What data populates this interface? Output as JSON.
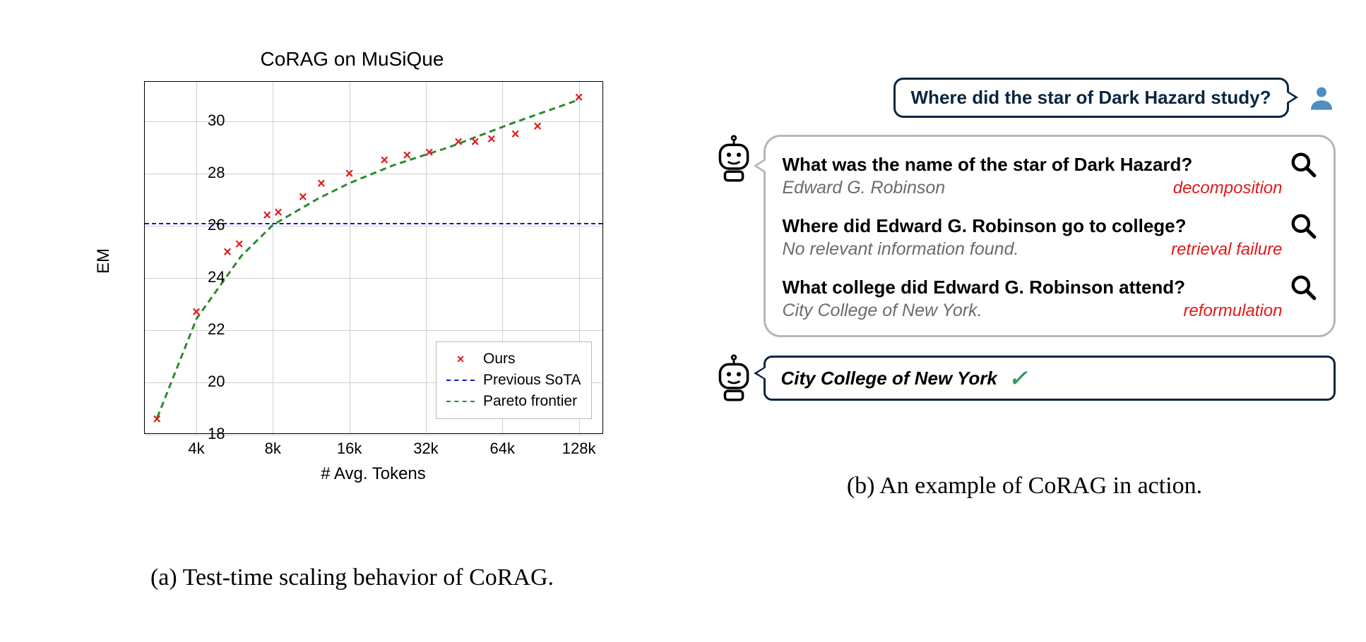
{
  "chart_data": {
    "type": "scatter",
    "title": "CoRAG on MuSiQue",
    "xlabel": "# Avg. Tokens",
    "ylabel": "EM",
    "xscale": "log",
    "xlim": [
      2500,
      160000
    ],
    "ylim": [
      18,
      31.5
    ],
    "xticks": [
      "4k",
      "8k",
      "16k",
      "32k",
      "64k",
      "128k"
    ],
    "yticks": [
      18,
      20,
      22,
      24,
      26,
      28,
      30
    ],
    "series": [
      {
        "name": "Ours",
        "type": "scatter",
        "marker": "x",
        "color": "#e11919",
        "points": [
          {
            "x": 2800,
            "y": 18.6
          },
          {
            "x": 4000,
            "y": 22.7
          },
          {
            "x": 5300,
            "y": 25.0
          },
          {
            "x": 5900,
            "y": 25.3
          },
          {
            "x": 7600,
            "y": 26.4
          },
          {
            "x": 8400,
            "y": 26.5
          },
          {
            "x": 10500,
            "y": 27.1
          },
          {
            "x": 12400,
            "y": 27.6
          },
          {
            "x": 16000,
            "y": 28.0
          },
          {
            "x": 22000,
            "y": 28.5
          },
          {
            "x": 27000,
            "y": 28.7
          },
          {
            "x": 33000,
            "y": 28.8
          },
          {
            "x": 43000,
            "y": 29.2
          },
          {
            "x": 50000,
            "y": 29.2
          },
          {
            "x": 58000,
            "y": 29.3
          },
          {
            "x": 72000,
            "y": 29.5
          },
          {
            "x": 88000,
            "y": 29.8
          },
          {
            "x": 128000,
            "y": 30.9
          }
        ]
      },
      {
        "name": "Previous SoTA",
        "type": "hline",
        "color": "#1313d8",
        "y": 26.1
      },
      {
        "name": "Pareto frontier",
        "type": "line",
        "color": "#2a8b2a",
        "points": [
          {
            "x": 2800,
            "y": 18.6
          },
          {
            "x": 4000,
            "y": 22.4
          },
          {
            "x": 6000,
            "y": 24.8
          },
          {
            "x": 8000,
            "y": 26.0
          },
          {
            "x": 12000,
            "y": 27.0
          },
          {
            "x": 16000,
            "y": 27.6
          },
          {
            "x": 24000,
            "y": 28.3
          },
          {
            "x": 40000,
            "y": 29.0
          },
          {
            "x": 70000,
            "y": 29.9
          },
          {
            "x": 128000,
            "y": 30.8
          }
        ]
      }
    ]
  },
  "legend": {
    "ours": "Ours",
    "sota": "Previous SoTA",
    "pareto": "Pareto frontier"
  },
  "captions": {
    "a": "(a)  Test-time scaling behavior of CoRAG.",
    "b": "(b)  An example of CoRAG in action."
  },
  "example": {
    "user_question": "Where did the star of Dark Hazard study?",
    "steps": [
      {
        "q": "What was the name of the star of Dark Hazard?",
        "a": "Edward G. Robinson",
        "tag": "decomposition"
      },
      {
        "q": "Where did Edward G. Robinson go to college?",
        "a": "No relevant information found.",
        "tag": "retrieval failure"
      },
      {
        "q": "What college did Edward G. Robinson attend?",
        "a": "City College of New York.",
        "tag": "reformulation"
      }
    ],
    "answer": "City College of New York"
  }
}
